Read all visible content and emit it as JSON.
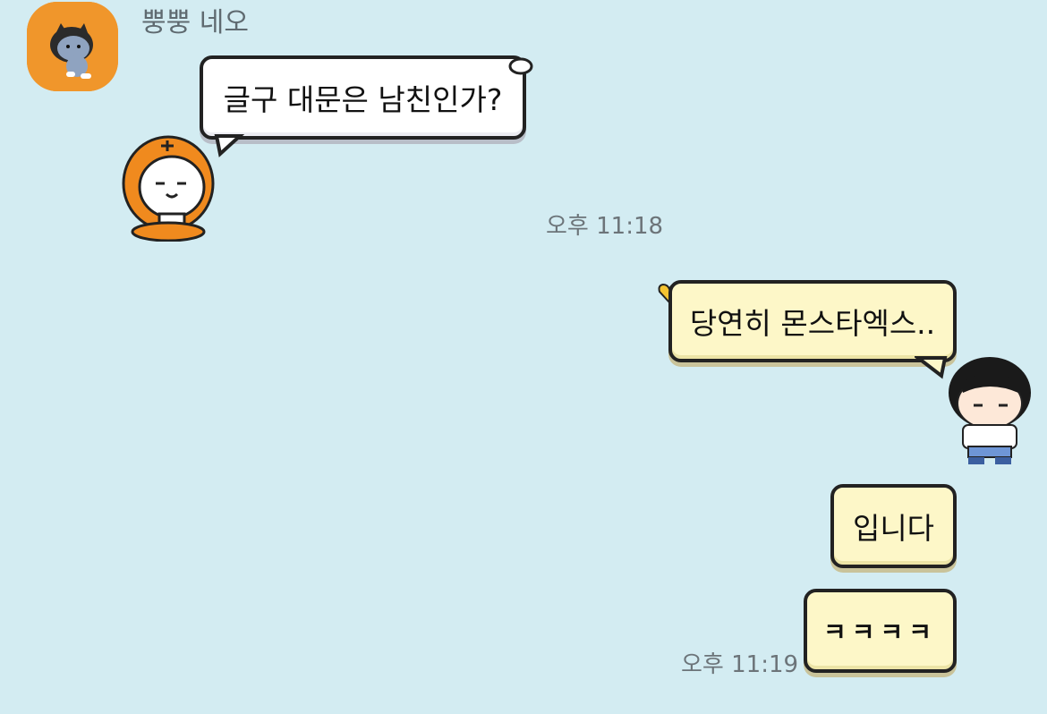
{
  "sender": {
    "name": "뿡뿡 네오"
  },
  "messages": [
    {
      "text": "글구 대문은 남친인가?",
      "direction": "incoming"
    },
    {
      "text": "당연히 몬스타엑스..",
      "direction": "outgoing"
    },
    {
      "text": "입니다",
      "direction": "outgoing"
    },
    {
      "text": "ㅋㅋㅋㅋ",
      "direction": "outgoing"
    }
  ],
  "timestamps": {
    "incoming": "오후 11:18",
    "outgoing": "오후 11:19"
  },
  "colors": {
    "background": "#d3ecf2",
    "incoming_bubble": "#ffffff",
    "outgoing_bubble": "#fdf7c8",
    "avatar_bg": "#f0962b"
  }
}
